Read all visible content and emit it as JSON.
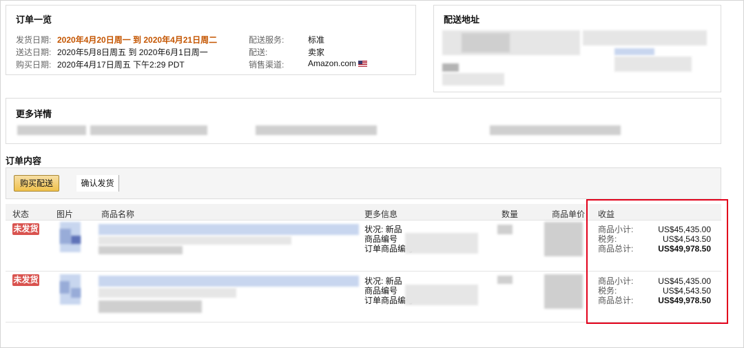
{
  "summary": {
    "title": "订单一览",
    "ship_date_label": "发货日期:",
    "ship_date_value": "2020年4月20日周一 到 2020年4月21日周二",
    "deliver_date_label": "送达日期:",
    "deliver_date_value": "2020年5月8日周五 到 2020年6月1日周一",
    "purchase_date_label": "购买日期:",
    "purchase_date_value": "2020年4月17日周五 下午2:29 PDT",
    "ship_service_label": "配送服务:",
    "ship_service_value": "标准",
    "fulfillment_label": "配送:",
    "fulfillment_value": "卖家",
    "channel_label": "销售渠道:",
    "channel_value": "Amazon.com",
    "channel_flag_icon": "us-flag-icon"
  },
  "address": {
    "title": "配送地址"
  },
  "details": {
    "title": "更多详情"
  },
  "order_contents": {
    "title": "订单内容",
    "buy_shipping_label": "购买配送",
    "confirm_ship_label": "确认发货"
  },
  "table": {
    "headers": {
      "status": "状态",
      "image": "图片",
      "name": "商品名称",
      "more_info": "更多信息",
      "quantity": "数量",
      "unit_price": "商品单价",
      "revenue": "收益"
    },
    "rows": [
      {
        "status": "未发货",
        "condition": "状况: 新品",
        "item_no_label": "商品编号",
        "order_item_no_label": "订单商品编号",
        "subtotal_label": "商品小计:",
        "subtotal_value": "US$45,435.00",
        "tax_label": "税务:",
        "tax_value": "US$4,543.50",
        "total_label": "商品总计:",
        "total_value": "US$49,978.50"
      },
      {
        "status": "未发货",
        "condition": "状况: 新品",
        "item_no_label": "商品编号",
        "order_item_no_label": "订单商品编号",
        "subtotal_label": "商品小计:",
        "subtotal_value": "US$45,435.00",
        "tax_label": "税务:",
        "tax_value": "US$4,543.50",
        "total_label": "商品总计:",
        "total_value": "US$49,978.50"
      }
    ]
  },
  "colors": {
    "accent_orange": "#c45500",
    "badge_red": "#d9534f",
    "highlight_red": "#e2001a",
    "button_yellow": "#f0c14b"
  }
}
